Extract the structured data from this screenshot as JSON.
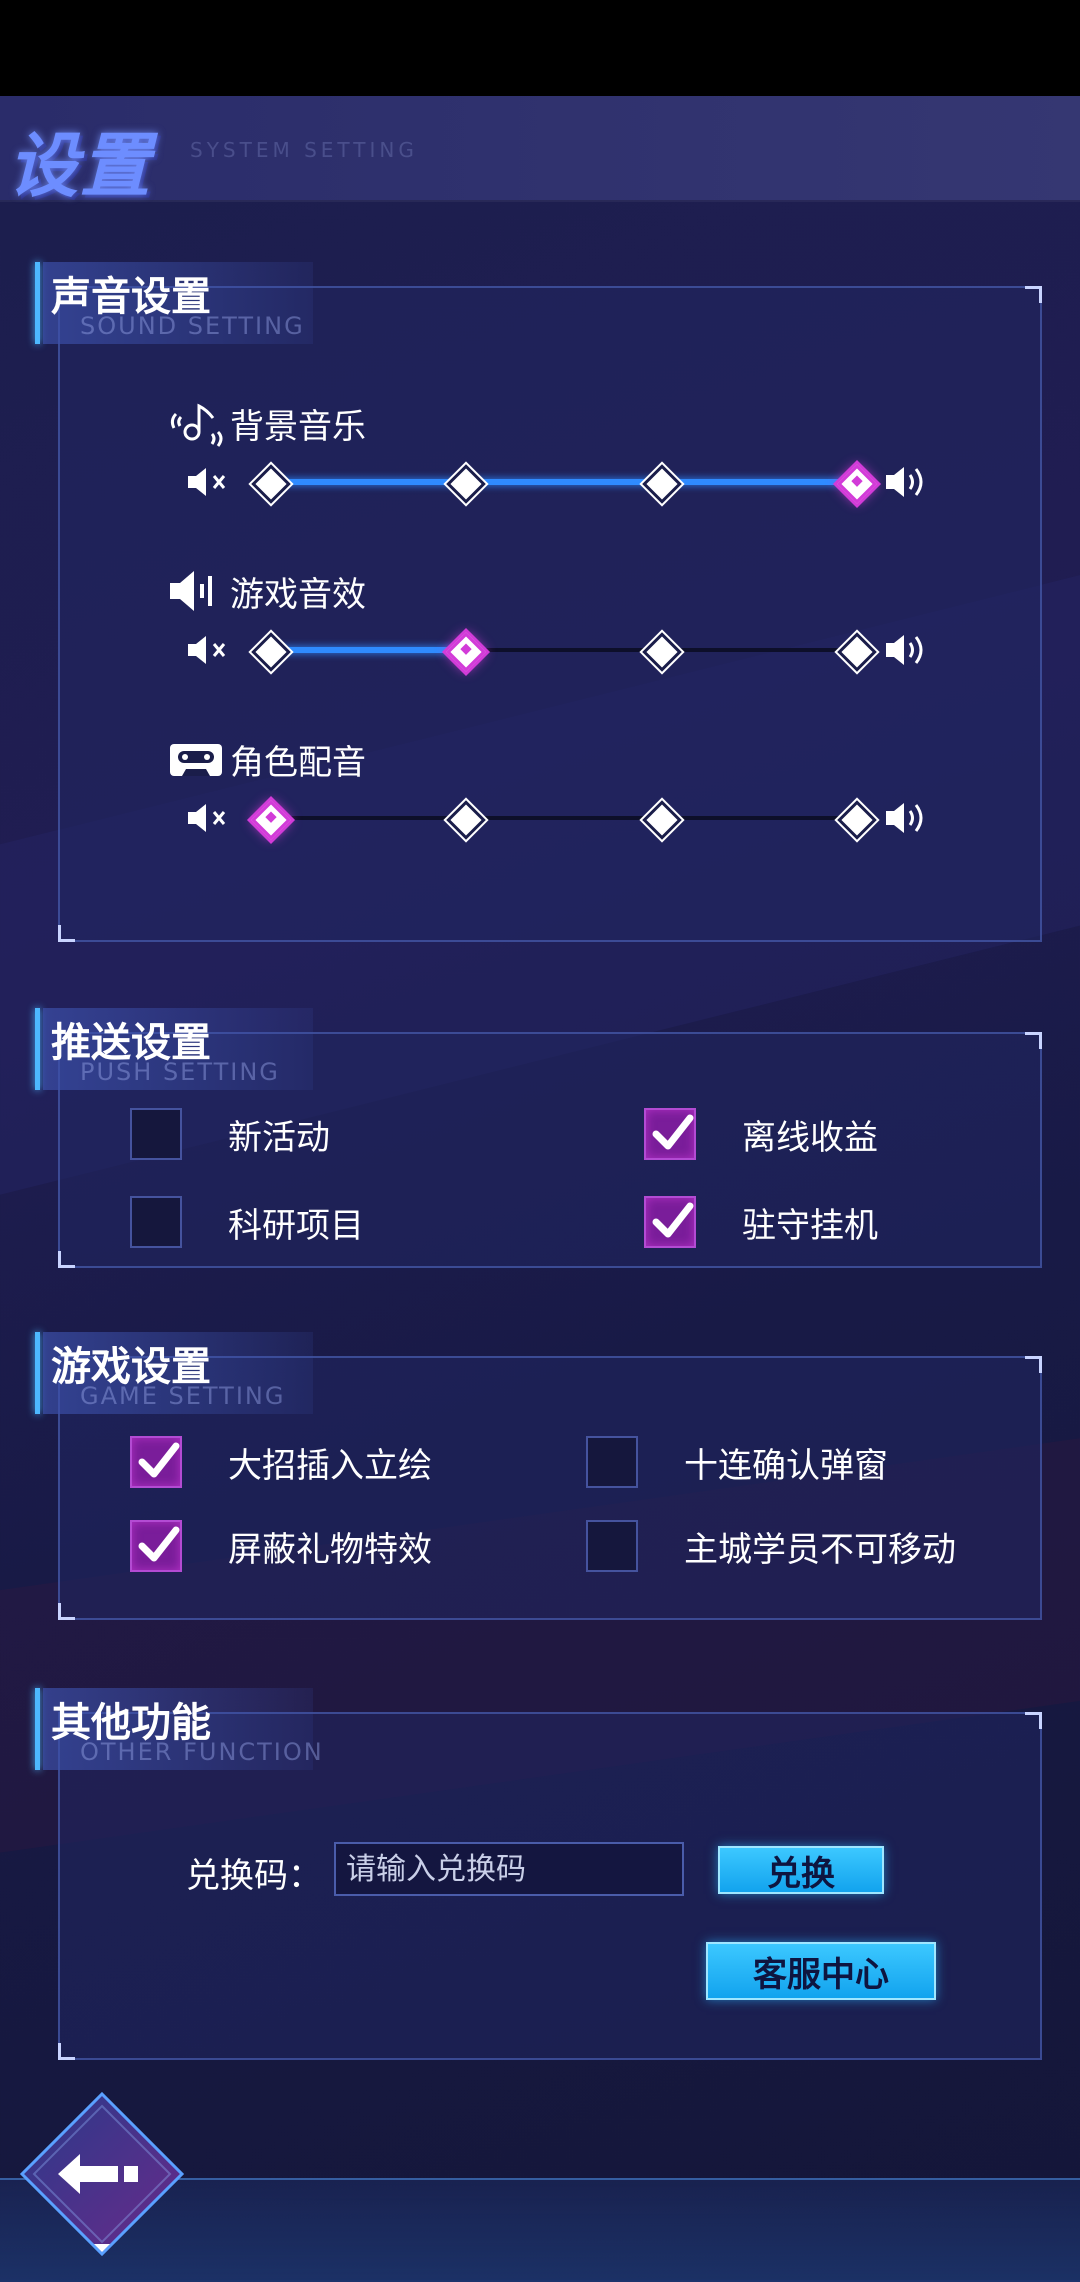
{
  "header": {
    "title": "设置",
    "subtitle": "SYSTEM SETTING"
  },
  "sound": {
    "title": "声音设置",
    "subtitle": "SOUND SETTING",
    "items": [
      {
        "label": "背景音乐",
        "icon": "music-note-icon",
        "level": 3,
        "max": 3
      },
      {
        "label": "游戏音效",
        "icon": "speaker-icon",
        "level": 1,
        "max": 3
      },
      {
        "label": "角色配音",
        "icon": "cassette-icon",
        "level": 0,
        "max": 3
      }
    ]
  },
  "push": {
    "title": "推送设置",
    "subtitle": "PUSH SETTING",
    "items": [
      {
        "label": "新活动",
        "checked": false
      },
      {
        "label": "离线收益",
        "checked": true
      },
      {
        "label": "科研项目",
        "checked": false
      },
      {
        "label": "驻守挂机",
        "checked": true
      }
    ]
  },
  "game": {
    "title": "游戏设置",
    "subtitle": "GAME SETTING",
    "items": [
      {
        "label": "大招插入立绘",
        "checked": true
      },
      {
        "label": "十连确认弹窗",
        "checked": false
      },
      {
        "label": "屏蔽礼物特效",
        "checked": true
      },
      {
        "label": "主城学员不可移动",
        "checked": false
      }
    ]
  },
  "other": {
    "title": "其他功能",
    "subtitle": "OTHER FUNCTION",
    "redeem_label": "兑换码：",
    "redeem_placeholder": "请输入兑换码",
    "redeem_button": "兑换",
    "service_button": "客服中心"
  },
  "colors": {
    "accent_blue": "#2f8bff",
    "accent_purple": "#d23bd8",
    "button": "#12a3ee"
  }
}
